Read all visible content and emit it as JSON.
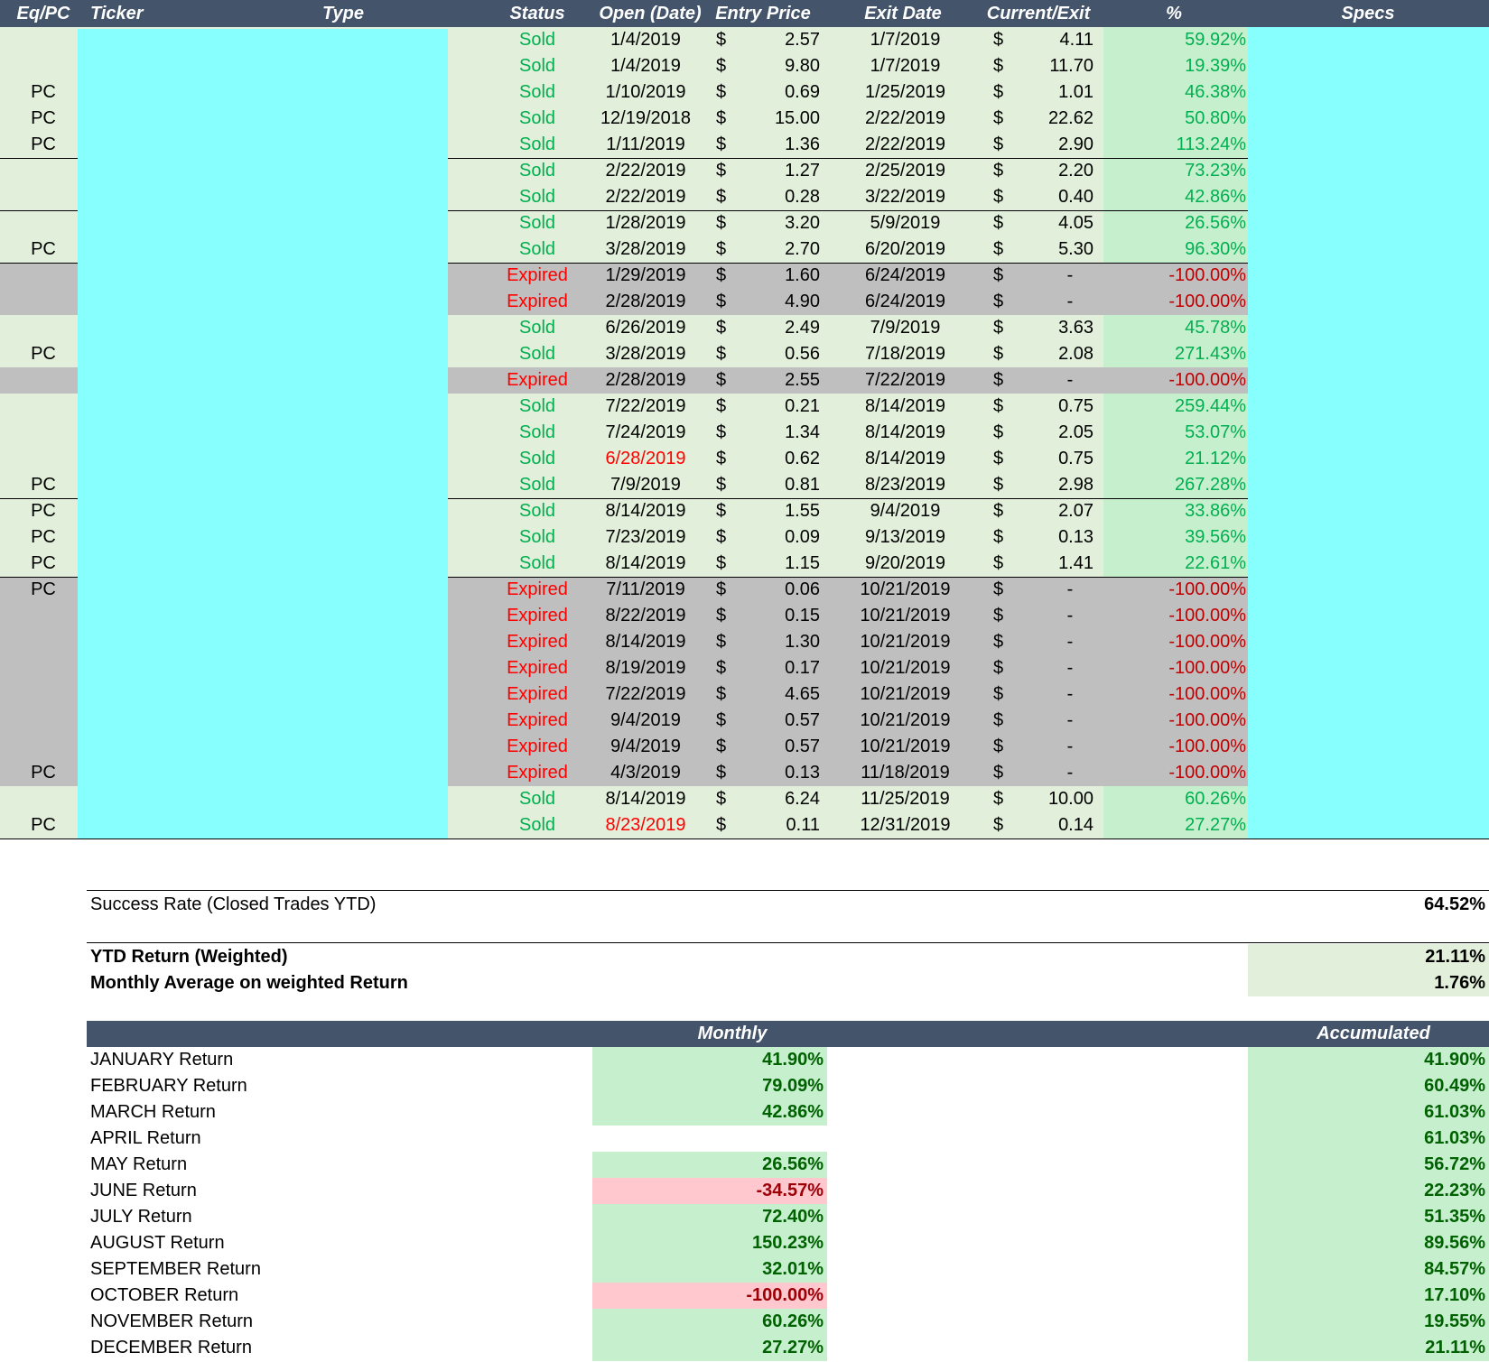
{
  "headers": {
    "eqpc": "Eq/PC",
    "ticker": "Ticker",
    "type": "Type",
    "status": "Status",
    "open_date": "Open (Date)",
    "entry_price": "Entry Price",
    "exit_date": "Exit Date",
    "current_exit": "Current/Exit",
    "pct": "%",
    "specs": "Specs"
  },
  "colors": {
    "header_bg": "#44546a",
    "sold_row_bg": "#e2efda",
    "expired_row_bg": "#bfbfbf",
    "redacted_cyan": "#88ffff",
    "positive_pct_bg": "#c6efce",
    "negative_month_bg": "#ffc7ce",
    "sold_text": "#00b050",
    "expired_text": "#ff0000"
  },
  "trades": [
    {
      "eqpc": "",
      "status": "Sold",
      "open": "1/4/2019",
      "open_red": false,
      "cur": "$",
      "entry": "2.57",
      "exit": "1/7/2019",
      "cur2": "$",
      "current": "4.11",
      "pct": "59.92%"
    },
    {
      "eqpc": "",
      "status": "Sold",
      "open": "1/4/2019",
      "open_red": false,
      "cur": "$",
      "entry": "9.80",
      "exit": "1/7/2019",
      "cur2": "$",
      "current": "11.70",
      "pct": "19.39%"
    },
    {
      "eqpc": "PC",
      "status": "Sold",
      "open": "1/10/2019",
      "open_red": false,
      "cur": "$",
      "entry": "0.69",
      "exit": "1/25/2019",
      "cur2": "$",
      "current": "1.01",
      "pct": "46.38%"
    },
    {
      "eqpc": "PC",
      "status": "Sold",
      "open": "12/19/2018",
      "open_red": false,
      "cur": "$",
      "entry": "15.00",
      "exit": "2/22/2019",
      "cur2": "$",
      "current": "22.62",
      "pct": "50.80%"
    },
    {
      "eqpc": "PC",
      "status": "Sold",
      "open": "1/11/2019",
      "open_red": false,
      "cur": "$",
      "entry": "1.36",
      "exit": "2/22/2019",
      "cur2": "$",
      "current": "2.90",
      "pct": "113.24%"
    },
    {
      "eqpc": "",
      "status": "Sold",
      "open": "2/22/2019",
      "open_red": false,
      "cur": "$",
      "entry": "1.27",
      "exit": "2/25/2019",
      "cur2": "$",
      "current": "2.20",
      "pct": "73.23%"
    },
    {
      "eqpc": "",
      "status": "Sold",
      "open": "2/22/2019",
      "open_red": false,
      "cur": "$",
      "entry": "0.28",
      "exit": "3/22/2019",
      "cur2": "$",
      "current": "0.40",
      "pct": "42.86%"
    },
    {
      "eqpc": "",
      "status": "Sold",
      "open": "1/28/2019",
      "open_red": false,
      "cur": "$",
      "entry": "3.20",
      "exit": "5/9/2019",
      "cur2": "$",
      "current": "4.05",
      "pct": "26.56%"
    },
    {
      "eqpc": "PC",
      "status": "Sold",
      "open": "3/28/2019",
      "open_red": false,
      "cur": "$",
      "entry": "2.70",
      "exit": "6/20/2019",
      "cur2": "$",
      "current": "5.30",
      "pct": "96.30%"
    },
    {
      "eqpc": "",
      "status": "Expired",
      "open": "1/29/2019",
      "open_red": false,
      "cur": "$",
      "entry": "1.60",
      "exit": "6/24/2019",
      "cur2": "$",
      "current": "-",
      "pct": "-100.00%"
    },
    {
      "eqpc": "",
      "status": "Expired",
      "open": "2/28/2019",
      "open_red": false,
      "cur": "$",
      "entry": "4.90",
      "exit": "6/24/2019",
      "cur2": "$",
      "current": "-",
      "pct": "-100.00%"
    },
    {
      "eqpc": "",
      "status": "Sold",
      "open": "6/26/2019",
      "open_red": false,
      "cur": "$",
      "entry": "2.49",
      "exit": "7/9/2019",
      "cur2": "$",
      "current": "3.63",
      "pct": "45.78%"
    },
    {
      "eqpc": "PC",
      "status": "Sold",
      "open": "3/28/2019",
      "open_red": false,
      "cur": "$",
      "entry": "0.56",
      "exit": "7/18/2019",
      "cur2": "$",
      "current": "2.08",
      "pct": "271.43%"
    },
    {
      "eqpc": "",
      "status": "Expired",
      "open": "2/28/2019",
      "open_red": false,
      "cur": "$",
      "entry": "2.55",
      "exit": "7/22/2019",
      "cur2": "$",
      "current": "-",
      "pct": "-100.00%"
    },
    {
      "eqpc": "",
      "status": "Sold",
      "open": "7/22/2019",
      "open_red": false,
      "cur": "$",
      "entry": "0.21",
      "exit": "8/14/2019",
      "cur2": "$",
      "current": "0.75",
      "pct": "259.44%"
    },
    {
      "eqpc": "",
      "status": "Sold",
      "open": "7/24/2019",
      "open_red": false,
      "cur": "$",
      "entry": "1.34",
      "exit": "8/14/2019",
      "cur2": "$",
      "current": "2.05",
      "pct": "53.07%"
    },
    {
      "eqpc": "",
      "status": "Sold",
      "open": "6/28/2019",
      "open_red": true,
      "cur": "$",
      "entry": "0.62",
      "exit": "8/14/2019",
      "cur2": "$",
      "current": "0.75",
      "pct": "21.12%"
    },
    {
      "eqpc": "PC",
      "status": "Sold",
      "open": "7/9/2019",
      "open_red": false,
      "cur": "$",
      "entry": "0.81",
      "exit": "8/23/2019",
      "cur2": "$",
      "current": "2.98",
      "pct": "267.28%"
    },
    {
      "eqpc": "PC",
      "status": "Sold",
      "open": "8/14/2019",
      "open_red": false,
      "cur": "$",
      "entry": "1.55",
      "exit": "9/4/2019",
      "cur2": "$",
      "current": "2.07",
      "pct": "33.86%"
    },
    {
      "eqpc": "PC",
      "status": "Sold",
      "open": "7/23/2019",
      "open_red": false,
      "cur": "$",
      "entry": "0.09",
      "exit": "9/13/2019",
      "cur2": "$",
      "current": "0.13",
      "pct": "39.56%"
    },
    {
      "eqpc": "PC",
      "status": "Sold",
      "open": "8/14/2019",
      "open_red": false,
      "cur": "$",
      "entry": "1.15",
      "exit": "9/20/2019",
      "cur2": "$",
      "current": "1.41",
      "pct": "22.61%"
    },
    {
      "eqpc": "PC",
      "status": "Expired",
      "open": "7/11/2019",
      "open_red": false,
      "cur": "$",
      "entry": "0.06",
      "exit": "10/21/2019",
      "cur2": "$",
      "current": "-",
      "pct": "-100.00%"
    },
    {
      "eqpc": "",
      "status": "Expired",
      "open": "8/22/2019",
      "open_red": false,
      "cur": "$",
      "entry": "0.15",
      "exit": "10/21/2019",
      "cur2": "$",
      "current": "-",
      "pct": "-100.00%"
    },
    {
      "eqpc": "",
      "status": "Expired",
      "open": "8/14/2019",
      "open_red": false,
      "cur": "$",
      "entry": "1.30",
      "exit": "10/21/2019",
      "cur2": "$",
      "current": "-",
      "pct": "-100.00%"
    },
    {
      "eqpc": "",
      "status": "Expired",
      "open": "8/19/2019",
      "open_red": false,
      "cur": "$",
      "entry": "0.17",
      "exit": "10/21/2019",
      "cur2": "$",
      "current": "-",
      "pct": "-100.00%"
    },
    {
      "eqpc": "",
      "status": "Expired",
      "open": "7/22/2019",
      "open_red": false,
      "cur": "$",
      "entry": "4.65",
      "exit": "10/21/2019",
      "cur2": "$",
      "current": "-",
      "pct": "-100.00%"
    },
    {
      "eqpc": "",
      "status": "Expired",
      "open": "9/4/2019",
      "open_red": false,
      "cur": "$",
      "entry": "0.57",
      "exit": "10/21/2019",
      "cur2": "$",
      "current": "-",
      "pct": "-100.00%"
    },
    {
      "eqpc": "",
      "status": "Expired",
      "open": "9/4/2019",
      "open_red": false,
      "cur": "$",
      "entry": "0.57",
      "exit": "10/21/2019",
      "cur2": "$",
      "current": "-",
      "pct": "-100.00%"
    },
    {
      "eqpc": "PC",
      "status": "Expired",
      "open": "4/3/2019",
      "open_red": false,
      "cur": "$",
      "entry": "0.13",
      "exit": "11/18/2019",
      "cur2": "$",
      "current": "-",
      "pct": "-100.00%"
    },
    {
      "eqpc": "",
      "status": "Sold",
      "open": "8/14/2019",
      "open_red": false,
      "cur": "$",
      "entry": "6.24",
      "exit": "11/25/2019",
      "cur2": "$",
      "current": "10.00",
      "pct": "60.26%"
    },
    {
      "eqpc": "PC",
      "status": "Sold",
      "open": "8/23/2019",
      "open_red": true,
      "cur": "$",
      "entry": "0.11",
      "exit": "12/31/2019",
      "cur2": "$",
      "current": "0.14",
      "pct": "27.27%"
    }
  ],
  "summary": {
    "success_rate_label": "Success Rate (Closed Trades YTD)",
    "success_rate_value": "64.52%",
    "ytd_label": "YTD Return (Weighted)",
    "ytd_value": "21.11%",
    "monthly_avg_label": "Monthly Average on weighted Return",
    "monthly_avg_value": "1.76%"
  },
  "monthly": {
    "header_monthly": "Monthly",
    "header_accumulated": "Accumulated",
    "rows": [
      {
        "label": "JANUARY Return",
        "monthly": "41.90%",
        "neg": false,
        "acc": "41.90%"
      },
      {
        "label": "FEBRUARY Return",
        "monthly": "79.09%",
        "neg": false,
        "acc": "60.49%"
      },
      {
        "label": "MARCH Return",
        "monthly": "42.86%",
        "neg": false,
        "acc": "61.03%"
      },
      {
        "label": "APRIL Return",
        "monthly": "",
        "neg": false,
        "acc": "61.03%"
      },
      {
        "label": "MAY Return",
        "monthly": "26.56%",
        "neg": false,
        "acc": "56.72%"
      },
      {
        "label": "JUNE Return",
        "monthly": "-34.57%",
        "neg": true,
        "acc": "22.23%"
      },
      {
        "label": "JULY Return",
        "monthly": "72.40%",
        "neg": false,
        "acc": "51.35%"
      },
      {
        "label": "AUGUST Return",
        "monthly": "150.23%",
        "neg": false,
        "acc": "89.56%"
      },
      {
        "label": "SEPTEMBER Return",
        "monthly": "32.01%",
        "neg": false,
        "acc": "84.57%"
      },
      {
        "label": "OCTOBER Return",
        "monthly": "-100.00%",
        "neg": true,
        "acc": "17.10%"
      },
      {
        "label": "NOVEMBER Return",
        "monthly": "60.26%",
        "neg": false,
        "acc": "19.55%"
      },
      {
        "label": "DECEMBER Return",
        "monthly": "27.27%",
        "neg": false,
        "acc": "21.11%"
      }
    ]
  }
}
